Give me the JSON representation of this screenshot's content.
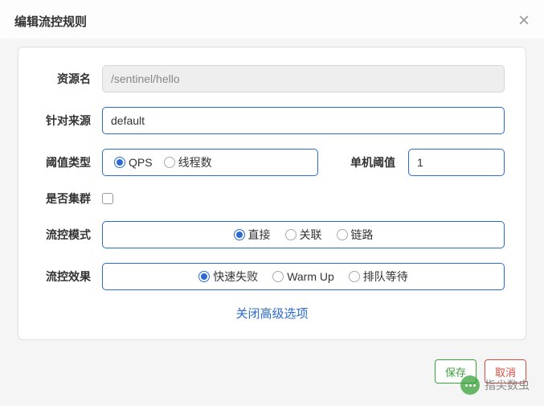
{
  "modal": {
    "title": "编辑流控规则",
    "close_advanced": "关闭高级选项"
  },
  "fields": {
    "resource_label": "资源名",
    "resource_value": "/sentinel/hello",
    "source_label": "针对来源",
    "source_value": "default",
    "threshold_type_label": "阈值类型",
    "threshold_unit_label": "单机阈值",
    "threshold_value": "1",
    "cluster_label": "是否集群",
    "mode_label": "流控模式",
    "effect_label": "流控效果"
  },
  "threshold_type_options": [
    {
      "label": "QPS",
      "selected": true
    },
    {
      "label": "线程数",
      "selected": false
    }
  ],
  "mode_options": [
    {
      "label": "直接",
      "selected": true
    },
    {
      "label": "关联",
      "selected": false
    },
    {
      "label": "链路",
      "selected": false
    }
  ],
  "effect_options": [
    {
      "label": "快速失败",
      "selected": true
    },
    {
      "label": "Warm Up",
      "selected": false
    },
    {
      "label": "排队等待",
      "selected": false
    }
  ],
  "buttons": {
    "save": "保存",
    "cancel": "取消"
  },
  "watermark": "指尖数虫"
}
